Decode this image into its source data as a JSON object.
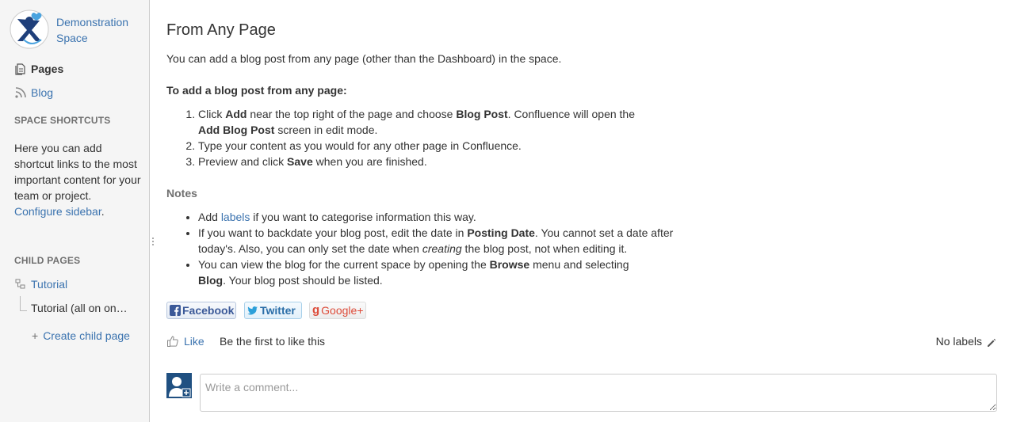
{
  "sidebar": {
    "space_name": "Demonstration Space",
    "nav": {
      "pages": "Pages",
      "blog": "Blog"
    },
    "shortcuts_heading": "SPACE SHORTCUTS",
    "shortcuts_text": "Here you can add shortcut links to the most important content for your team or project.",
    "configure_link": "Configure sidebar",
    "child_heading": "CHILD PAGES",
    "children": [
      {
        "label": "Tutorial"
      },
      {
        "label": "Tutorial (all on on…"
      }
    ],
    "create_child": "Create child page"
  },
  "main": {
    "title": "From Any Page",
    "intro": "You can add a blog post from any page (other than the Dashboard) in the space.",
    "steps_heading": "To add a blog post from any page:",
    "steps": [
      {
        "t1": "Click ",
        "b1": "Add",
        "t2": " near the top right of the page and choose ",
        "b2": "Blog Post",
        "t3": ". Confluence will open the ",
        "b3": "Add Blog Post",
        "t4": " screen in edit mode."
      },
      {
        "t1": "Type your content as you would for any other page in Confluence."
      },
      {
        "t1": "Preview and click ",
        "b1": "Save",
        "t2": " when you are finished."
      }
    ],
    "notes_heading": "Notes",
    "notes": [
      {
        "t1": "Add ",
        "link": "labels",
        "t2": " if you want to categorise information this way."
      },
      {
        "t1": "If you want to backdate your blog post, edit the date in ",
        "b1": "Posting Date",
        "t2": ". You cannot set a date after today's. Also, you can only set the date when ",
        "i1": "creating",
        "t3": " the blog post, not when editing it."
      },
      {
        "t1": "You can view the blog for the current space by opening the ",
        "b1": "Browse",
        "t2": " menu and selecting ",
        "b2": "Blog",
        "t3": ". Your blog post should be listed."
      }
    ],
    "share": {
      "facebook": "Facebook",
      "twitter": "Twitter",
      "google": "Google+"
    },
    "like": {
      "label": "Like",
      "text": "Be the first to like this"
    },
    "labels_text": "No labels",
    "comment_placeholder": "Write a comment..."
  },
  "colors": {
    "link": "#3b73af",
    "sidebar_bg": "#f5f5f5",
    "avatar": "#205081"
  }
}
